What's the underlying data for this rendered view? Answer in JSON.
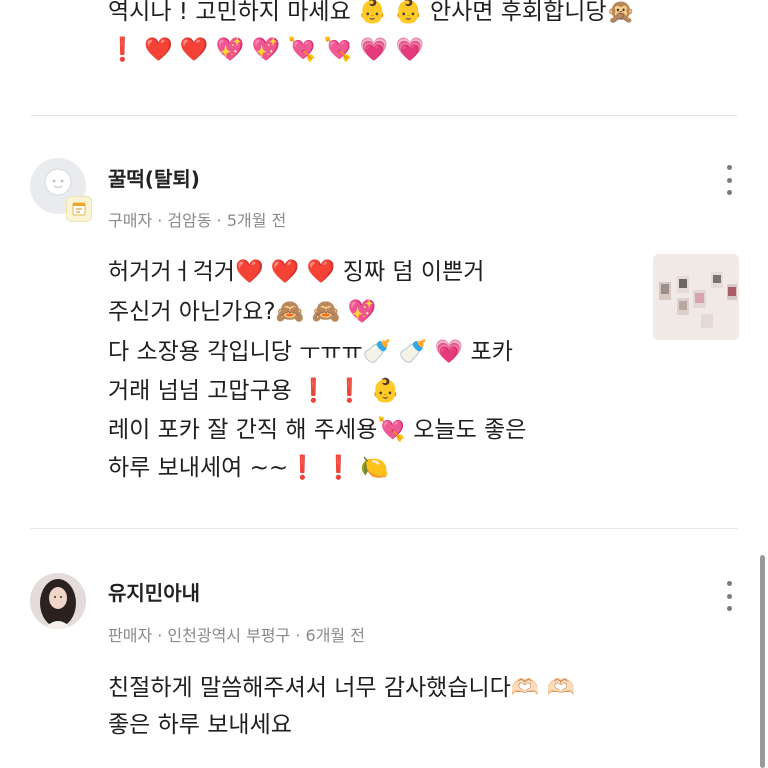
{
  "top_comment": {
    "line1": "역시나 ! 고민하지 마세요 👶 👶  안사면 후회합니당🙊",
    "line2": "❗ ❤️ ❤️ 💖 💖 💘 💘 💗 💗"
  },
  "review1": {
    "name": "꿀떡(탈퇴)",
    "meta": "구매자 · 검암동 · 5개월 전",
    "lines": [
      "허거거ㅓ걱거❤️ ❤️ ❤️  징짜 덤 이쁜거",
      "주신거 아닌가요?🙈 🙈 💖",
      "다 소장용 각입니당 ㅜㅠㅠ🍼 🍼 💗   포카",
      "거래 넘넘 고맙구용  ❗ ❗ 👶",
      "레이 포카 잘 간직 해 주세용💘  오늘도 좋은",
      "하루 보내세여 ~~❗ ❗ 🍋"
    ]
  },
  "review2": {
    "name": "유지민아내",
    "meta": "판매자 · 인천광역시 부평구 · 6개월 전",
    "lines": [
      "친절하게 말씀해주셔서 너무 감사했습니다🫶🏻 🫶🏻",
      "좋은 하루 보내세요"
    ]
  },
  "icons": {
    "default_avatar": "default-avatar-icon",
    "badge": "calendar-badge-icon",
    "more": "more-vertical-icon"
  },
  "colors": {
    "meta_text": "#8a8a8a",
    "divider": "#e6e6e6"
  }
}
